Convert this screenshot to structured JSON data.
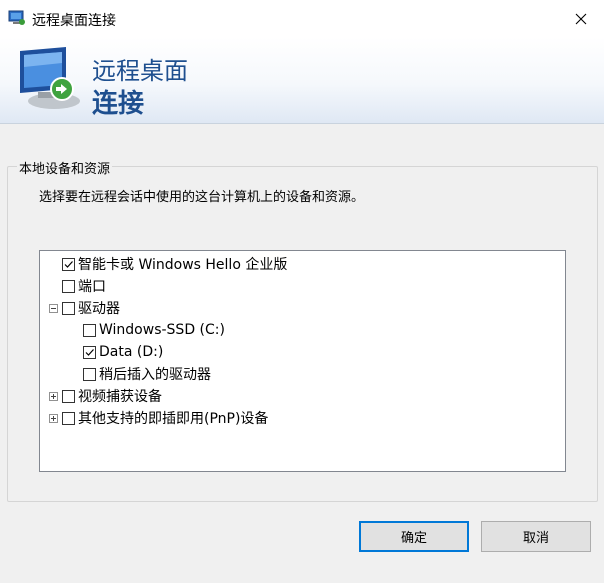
{
  "window": {
    "title": "远程桌面连接",
    "close_icon": "close-icon"
  },
  "banner": {
    "title_line1": "远程桌面",
    "title_line2": "连接"
  },
  "group": {
    "legend": "本地设备和资源",
    "description": "选择要在远程会话中使用的这台计算机上的设备和资源。"
  },
  "tree": {
    "smartcard": {
      "label": "智能卡或 Windows Hello 企业版",
      "checked": true
    },
    "ports": {
      "label": "端口",
      "checked": false
    },
    "drives": {
      "label": "驱动器",
      "checked": false,
      "expanded": true
    },
    "drive_c": {
      "label": "Windows-SSD (C:)",
      "checked": false
    },
    "drive_d": {
      "label": "Data (D:)",
      "checked": true
    },
    "drive_later": {
      "label": "稍后插入的驱动器",
      "checked": false
    },
    "video": {
      "label": "视频捕获设备",
      "checked": false,
      "expanded": false
    },
    "pnp": {
      "label": "其他支持的即插即用(PnP)设备",
      "checked": false,
      "expanded": false
    }
  },
  "buttons": {
    "ok": "确定",
    "cancel": "取消"
  },
  "colors": {
    "accent": "#0078d7",
    "banner_text": "#1e4f8f"
  }
}
